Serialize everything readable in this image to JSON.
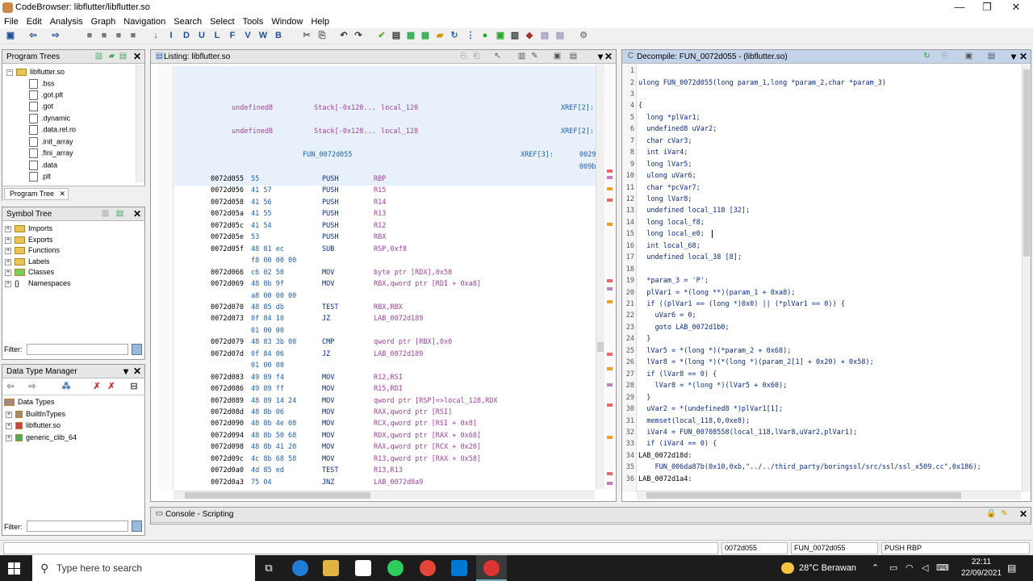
{
  "window": {
    "title": "CodeBrowser: libflutter/libflutter.so"
  },
  "menu": [
    "File",
    "Edit",
    "Analysis",
    "Graph",
    "Navigation",
    "Search",
    "Select",
    "Tools",
    "Window",
    "Help"
  ],
  "program_trees": {
    "title": "Program Trees",
    "root": "libflutter.so",
    "items": [
      ".bss",
      ".got.plt",
      ".got",
      ".dynamic",
      ".data.rel.ro",
      ".init_array",
      ".fini_array",
      ".data",
      ".plt"
    ],
    "tab": "Program Tree"
  },
  "symbol_tree": {
    "title": "Symbol Tree",
    "items": [
      "Imports",
      "Exports",
      "Functions",
      "Labels",
      "Classes",
      "Namespaces"
    ],
    "filter_label": "Filter:"
  },
  "data_type_manager": {
    "title": "Data Type Manager",
    "items": [
      "Data Types",
      "BuiltInTypes",
      "libflutter.so",
      "generic_clib_64"
    ],
    "filter_label": "Filter:"
  },
  "listing": {
    "title": "Listing:  libflutter.so",
    "header_rows": [
      {
        "type": "undefined8",
        "loc": "Stack[-0x120...",
        "name": "local_120",
        "xref": "XREF[2]:"
      },
      {
        "type": "undefined8",
        "loc": "Stack[-0x128...",
        "name": "local_128",
        "xref": "XREF[2]:"
      }
    ],
    "func_label": "FUN_0072d055",
    "func_xref": "XREF[3]:",
    "func_xref_addr1": "0029",
    "func_xref_addr2": "009b",
    "rows": [
      {
        "addr": "0072d055",
        "bytes": "55",
        "mnem": "PUSH",
        "ops": "RBP"
      },
      {
        "addr": "0072d056",
        "bytes": "41 57",
        "mnem": "PUSH",
        "ops": "R15"
      },
      {
        "addr": "0072d058",
        "bytes": "41 56",
        "mnem": "PUSH",
        "ops": "R14"
      },
      {
        "addr": "0072d05a",
        "bytes": "41 55",
        "mnem": "PUSH",
        "ops": "R13"
      },
      {
        "addr": "0072d05c",
        "bytes": "41 54",
        "mnem": "PUSH",
        "ops": "R12"
      },
      {
        "addr": "0072d05e",
        "bytes": "53",
        "mnem": "PUSH",
        "ops": "RBX"
      },
      {
        "addr": "0072d05f",
        "bytes": "48 81 ec",
        "mnem": "SUB",
        "ops": "RSP,0xf8"
      },
      {
        "addr": "",
        "bytes": "f8 00 00 00",
        "mnem": "",
        "ops": ""
      },
      {
        "addr": "0072d066",
        "bytes": "c6 02 50",
        "mnem": "MOV",
        "ops": "byte ptr [RDX],0x50"
      },
      {
        "addr": "0072d069",
        "bytes": "48 8b 9f",
        "mnem": "MOV",
        "ops": "RBX,qword ptr [RDI + 0xa8]"
      },
      {
        "addr": "",
        "bytes": "a8 00 00 00",
        "mnem": "",
        "ops": ""
      },
      {
        "addr": "0072d070",
        "bytes": "48 85 db",
        "mnem": "TEST",
        "ops": "RBX,RBX"
      },
      {
        "addr": "0072d073",
        "bytes": "0f 84 10",
        "mnem": "JZ",
        "ops": "LAB_0072d189"
      },
      {
        "addr": "",
        "bytes": "01 00 00",
        "mnem": "",
        "ops": ""
      },
      {
        "addr": "0072d079",
        "bytes": "48 83 3b 00",
        "mnem": "CMP",
        "ops": "qword ptr [RBX],0x0"
      },
      {
        "addr": "0072d07d",
        "bytes": "0f 84 06",
        "mnem": "JZ",
        "ops": "LAB_0072d189"
      },
      {
        "addr": "",
        "bytes": "01 00 00",
        "mnem": "",
        "ops": ""
      },
      {
        "addr": "0072d083",
        "bytes": "49 89 f4",
        "mnem": "MOV",
        "ops": "R12,RSI"
      },
      {
        "addr": "0072d086",
        "bytes": "49 89 ff",
        "mnem": "MOV",
        "ops": "R15,RDI"
      },
      {
        "addr": "0072d089",
        "bytes": "48 89 14 24",
        "mnem": "MOV",
        "ops": "qword ptr [RSP]=>local_128,RDX"
      },
      {
        "addr": "0072d08d",
        "bytes": "48 8b 06",
        "mnem": "MOV",
        "ops": "RAX,qword ptr [RSI]"
      },
      {
        "addr": "0072d090",
        "bytes": "48 8b 4e 08",
        "mnem": "MOV",
        "ops": "RCX,qword ptr [RSI + 0x8]"
      },
      {
        "addr": "0072d094",
        "bytes": "48 8b 50 68",
        "mnem": "MOV",
        "ops": "RDX,qword ptr [RAX + 0x68]"
      },
      {
        "addr": "0072d098",
        "bytes": "48 8b 41 20",
        "mnem": "MOV",
        "ops": "RAX,qword ptr [RCX + 0x20]"
      },
      {
        "addr": "0072d09c",
        "bytes": "4c 8b 68 58",
        "mnem": "MOV",
        "ops": "R13,qword ptr [RAX + 0x58]"
      },
      {
        "addr": "0072d0a0",
        "bytes": "4d 85 ed",
        "mnem": "TEST",
        "ops": "R13,R13"
      },
      {
        "addr": "0072d0a3",
        "bytes": "75 04",
        "mnem": "JNZ",
        "ops": "LAB_0072d0a9"
      }
    ]
  },
  "decompile": {
    "title": "Decompile: FUN_0072d055  -  (libflutter.so)",
    "lines": [
      "",
      "ulong FUN_0072d055(long param_1,long *param_2,char *param_3)",
      "",
      "{",
      "  long *plVar1;",
      "  undefined8 uVar2;",
      "  char cVar3;",
      "  int iVar4;",
      "  long lVar5;",
      "  ulong uVar6;",
      "  char *pcVar7;",
      "  long lVar8;",
      "  undefined local_118 [32];",
      "  long local_f8;",
      "  long local_e0;",
      "  int local_68;",
      "  undefined local_38 [8];",
      "",
      "  *param_3 = 'P';",
      "  plVar1 = *(long **)(param_1 + 0xa8);",
      "  if ((plVar1 == (long *)0x0) || (*plVar1 == 0)) {",
      "    uVar6 = 0;",
      "    goto LAB_0072d1b0;",
      "  }",
      "  lVar5 = *(long *)(*param_2 + 0x68);",
      "  lVar8 = *(long *)(*(long *)(param_2[1] + 0x20) + 0x58);",
      "  if (lVar8 == 0) {",
      "    lVar8 = *(long *)(lVar5 + 0x60);",
      "  }",
      "  uVar2 = *(undefined8 *)plVar1[1];",
      "  memset(local_118,0,0xe8);",
      "  iVar4 = FUN_00708558(local_118,lVar8,uVar2,plVar1);",
      "  if (iVar4 == 0) {",
      "LAB_0072d18d:",
      "    FUN_006da87b(0x10,0xb,\"../../third_party/boringssl/src/ssl/ssl_x509.cc\",0x186);",
      "LAB_0072d1a4:"
    ]
  },
  "console": {
    "title": "Console - Scripting"
  },
  "status": {
    "addr": "0072d055",
    "func": "FUN_0072d055",
    "instr": "PUSH RBP"
  },
  "taskbar": {
    "search_placeholder": "Type here to search",
    "weather": "28°C  Berawan",
    "time": "22:11",
    "date": "22/09/2021"
  }
}
